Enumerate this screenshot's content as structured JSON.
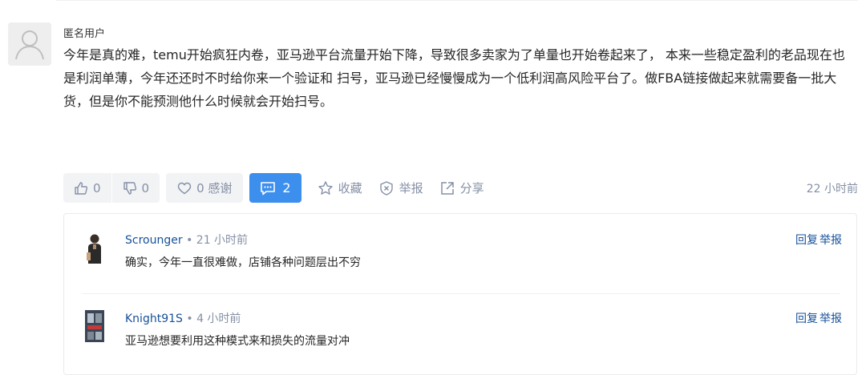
{
  "post": {
    "username": "匿名用户",
    "content": "今年是真的难，temu开始疯狂内卷，亚马逊平台流量开始下降，导致很多卖家为了单量也开始卷起来了， 本来一些稳定盈利的老品现在也是利润单薄，今年还还时不时给你来一个验证和 扫号，亚马逊已经慢慢成为一个低利润高风险平台了。做FBA链接做起来就需要备一批大货，但是你不能预测他什么时候就会开始扫号。",
    "time": "22 小时前",
    "avatar_icon": "user-silhouette-icon"
  },
  "actions": {
    "upvote_count": "0",
    "downvote_count": "0",
    "thanks_label": "0 感谢",
    "comment_count": "2",
    "favorite_label": "收藏",
    "report_label": "举报",
    "share_label": "分享",
    "accent_color": "#3d8fee"
  },
  "replies": [
    {
      "name": "Scrounger",
      "separator": "•",
      "time": "21 小时前",
      "text": "确实，今年一直很难做，店铺各种问题层出不穷",
      "reply_label": "回复",
      "report_label": "举报"
    },
    {
      "name": "Knight91S",
      "separator": "•",
      "time": "4 小时前",
      "text": "亚马逊想要利用这种模式来和损失的流量对冲",
      "reply_label": "回复",
      "report_label": "举报"
    }
  ]
}
